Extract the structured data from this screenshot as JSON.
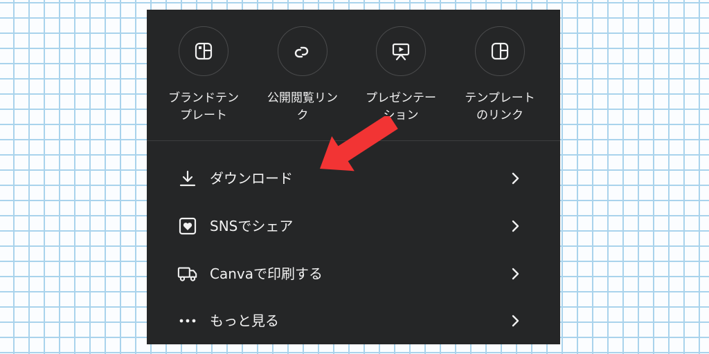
{
  "share_menu": {
    "quick_actions": [
      {
        "label": "ブランドテン\nプレート",
        "icon": "brand-template-icon"
      },
      {
        "label": "公開閲覧リン\nク",
        "icon": "link-icon"
      },
      {
        "label": "プレゼンテー\nション",
        "icon": "presentation-icon"
      },
      {
        "label": "テンプレート\nのリンク",
        "icon": "template-link-icon"
      }
    ],
    "menu_items": [
      {
        "label": "ダウンロード",
        "icon": "download-icon"
      },
      {
        "label": "SNSでシェア",
        "icon": "social-share-icon"
      },
      {
        "label": "Canvaで印刷する",
        "icon": "print-truck-icon"
      },
      {
        "label": "もっと見る",
        "icon": "more-icon"
      }
    ]
  },
  "colors": {
    "panel_background": "#252627",
    "grid_line": "#a9d3ec",
    "annotation_arrow": "#f23434"
  },
  "annotation": {
    "icon": "red-arrow-icon",
    "points_to": "ダウンロード"
  }
}
